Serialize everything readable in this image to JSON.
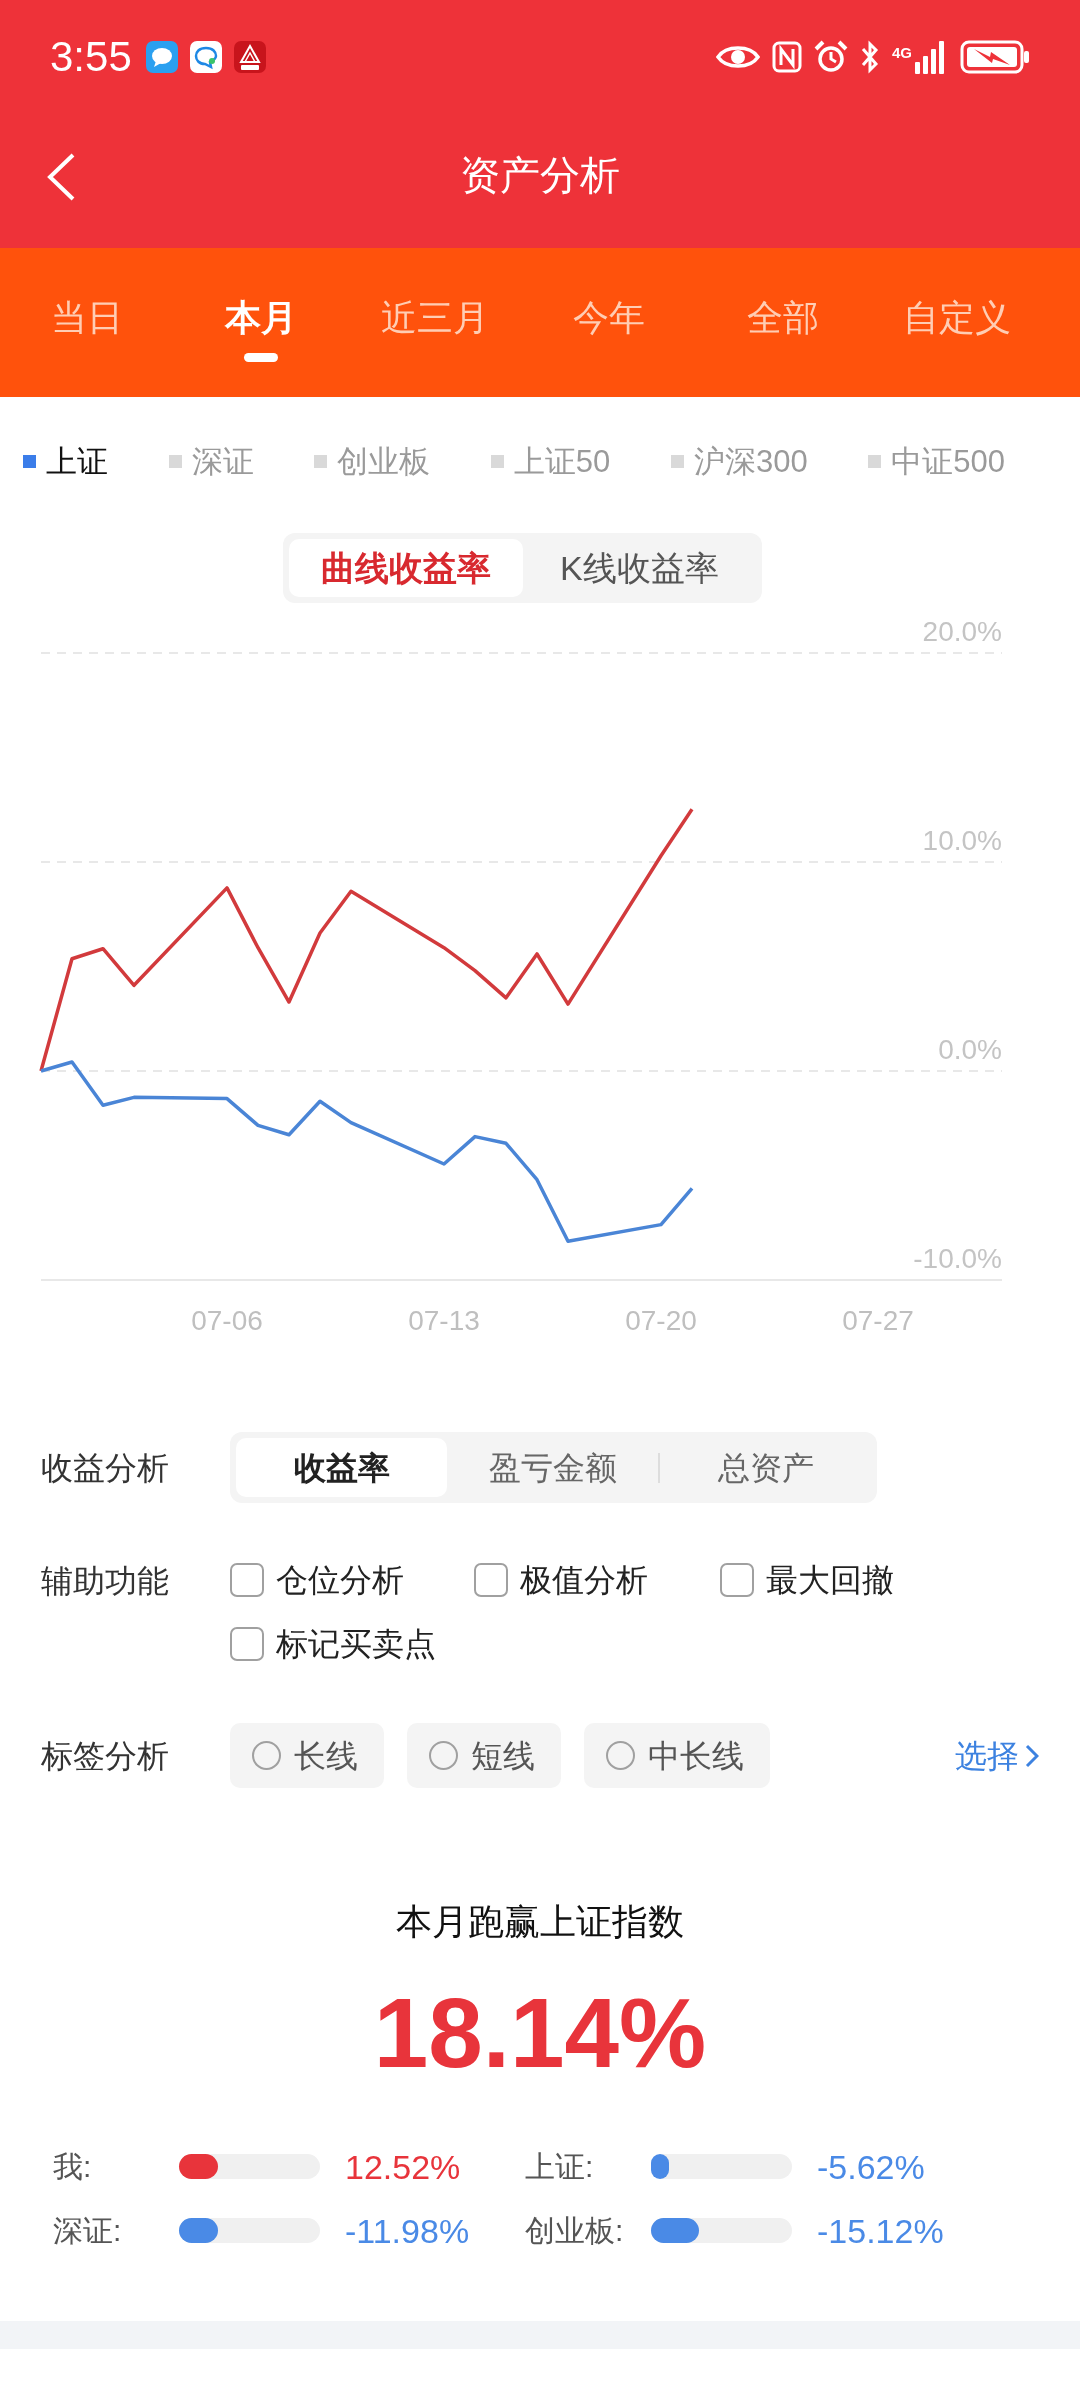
{
  "status_bar": {
    "time": "3:55",
    "network": "4G"
  },
  "header": {
    "title": "资产分析"
  },
  "period_tabs": [
    {
      "label": "当日",
      "selected": false
    },
    {
      "label": "本月",
      "selected": true
    },
    {
      "label": "近三月",
      "selected": false
    },
    {
      "label": "今年",
      "selected": false
    },
    {
      "label": "全部",
      "selected": false
    },
    {
      "label": "自定义",
      "selected": false
    }
  ],
  "legend": [
    {
      "label": "上证",
      "selected": true
    },
    {
      "label": "深证",
      "selected": false
    },
    {
      "label": "创业板",
      "selected": false
    },
    {
      "label": "上证50",
      "selected": false
    },
    {
      "label": "沪深300",
      "selected": false
    },
    {
      "label": "中证500",
      "selected": false
    }
  ],
  "chart_mode": [
    {
      "label": "曲线收益率",
      "selected": true
    },
    {
      "label": "K线收益率",
      "selected": false
    }
  ],
  "chart": {
    "chart_data": {
      "type": "line",
      "categories": [
        null,
        null,
        null,
        null,
        null,
        null,
        "07-06",
        null,
        null,
        null,
        null,
        null,
        null,
        "07-13",
        null,
        null,
        null,
        null,
        null,
        null,
        "07-20",
        null,
        null,
        null,
        null,
        null,
        null,
        "07-27",
        null,
        null,
        null,
        null
      ],
      "series": [
        {
          "color": "#d23a3c",
          "values": [
            0,
            5.37,
            5.85,
            4.1,
            null,
            null,
            8.76,
            5.9,
            3.3,
            6.6,
            8.6,
            null,
            null,
            5.9,
            4.8,
            3.5,
            5.6,
            3.2,
            null,
            null,
            10.3,
            12.52,
            null,
            null,
            null,
            null,
            null,
            null,
            null,
            null,
            null,
            null
          ]
        },
        {
          "color": "#4a85d6",
          "values": [
            0,
            0.43,
            -1.64,
            -1.26,
            null,
            null,
            -1.32,
            -2.6,
            -3.05,
            -1.45,
            -2.47,
            null,
            null,
            -4.45,
            -3.14,
            -3.46,
            -5.2,
            -8.15,
            null,
            null,
            -7.35,
            -5.62,
            null,
            null,
            null,
            null,
            null,
            null,
            null,
            null,
            null,
            null
          ]
        }
      ],
      "ylim": [
        -10,
        20
      ],
      "yticks": [
        {
          "value": -10,
          "label": "-10.0%"
        },
        {
          "value": 0,
          "label": "0.0%"
        },
        {
          "value": 10,
          "label": "10.0%"
        },
        {
          "value": 20,
          "label": "20.0%"
        }
      ]
    }
  },
  "return_analysis": {
    "label": "收益分析",
    "options": [
      {
        "label": "收益率",
        "selected": true
      },
      {
        "label": "盈亏金额",
        "selected": false
      },
      {
        "label": "总资产",
        "selected": false
      }
    ]
  },
  "auxiliary": {
    "label": "辅助功能",
    "options": [
      {
        "label": "仓位分析",
        "checked": false
      },
      {
        "label": "极值分析",
        "checked": false
      },
      {
        "label": "最大回撤",
        "checked": false
      },
      {
        "label": "标记买卖点",
        "checked": false
      }
    ]
  },
  "tag_analysis": {
    "label": "标签分析",
    "options": [
      {
        "label": "长线",
        "selected": false
      },
      {
        "label": "短线",
        "selected": false
      },
      {
        "label": "中长线",
        "selected": false
      }
    ],
    "link": "选择"
  },
  "summary": {
    "title": "本月跑赢上证指数",
    "value": "18.14%",
    "comparisons": [
      {
        "label": "我:",
        "level": 0.28,
        "reading": "12.52%",
        "color": "#e8343b"
      },
      {
        "label": "上证:",
        "level": 0.13,
        "reading": "-5.62%",
        "color": "#4a8ae6"
      },
      {
        "label": "深证:",
        "level": 0.28,
        "reading": "-11.98%",
        "color": "#4a8ae6"
      },
      {
        "label": "创业板:",
        "level": 0.34,
        "reading": "-15.12%",
        "color": "#4a8ae6"
      }
    ]
  }
}
